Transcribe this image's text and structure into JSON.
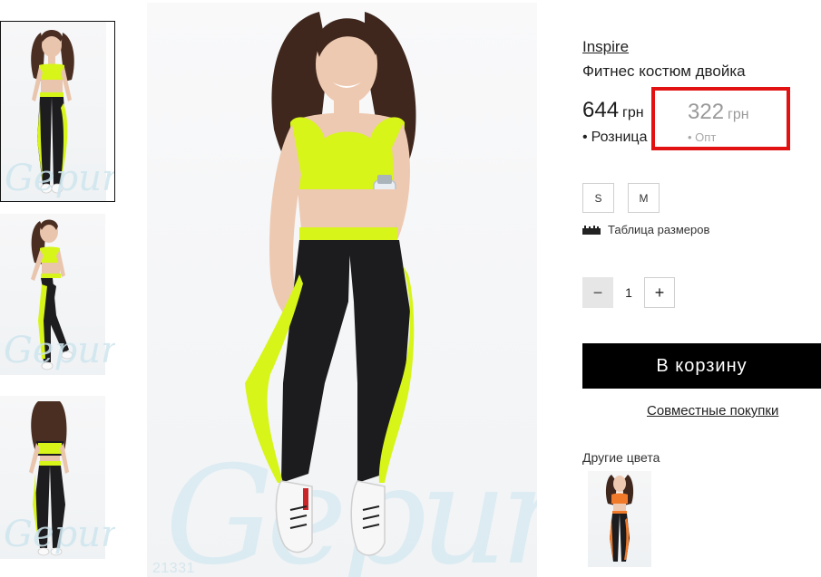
{
  "product": {
    "brand": "Inspire",
    "title": "Фитнес костюм двойка",
    "sku": "21331"
  },
  "watermark": {
    "main": "Gepur",
    "thumb": "Gepur"
  },
  "prices": {
    "retail": {
      "value": "644",
      "currency": "грн",
      "label": "Розница"
    },
    "wholesale": {
      "value": "322",
      "currency": "грн",
      "label": "Опт"
    }
  },
  "sizes": [
    "S",
    "M"
  ],
  "size_table_label": "Таблица размеров",
  "quantity": {
    "minus": "−",
    "value": "1",
    "plus": "+"
  },
  "cart_button": "В корзину",
  "joint_purchases": "Совместные покупки",
  "other_colors_label": "Другие цвета",
  "colors": {
    "accent": "#d7f518",
    "highlight_box": "#e31212",
    "cart_bg": "#000000",
    "alt_color": "#f07a2a"
  }
}
